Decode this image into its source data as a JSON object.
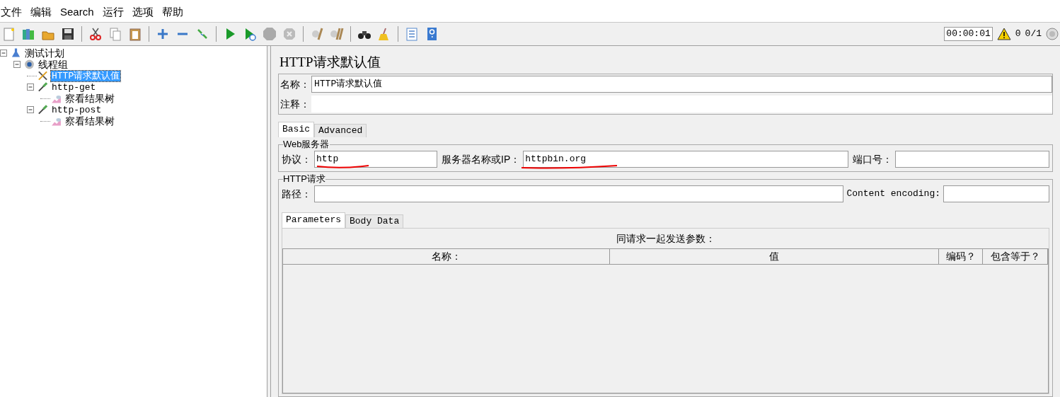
{
  "menu": [
    "文件",
    "编辑",
    "Search",
    "运行",
    "选项",
    "帮助"
  ],
  "status": {
    "timer": "00:00:01",
    "warnings": "0",
    "threads": "0/1"
  },
  "tree": [
    {
      "label": "测试计划",
      "kind": "plan",
      "selected": false,
      "expanded": true,
      "children": [
        {
          "label": "线程组",
          "kind": "threads",
          "selected": false,
          "expanded": true,
          "children": [
            {
              "label": "HTTP请求默认值",
              "kind": "config",
              "selected": true
            },
            {
              "label": "http-get",
              "kind": "sampler",
              "selected": false,
              "expanded": true,
              "children": [
                {
                  "label": "察看结果树",
                  "kind": "listener",
                  "selected": false
                }
              ]
            },
            {
              "label": "http-post",
              "kind": "sampler",
              "selected": false,
              "expanded": true,
              "children": [
                {
                  "label": "察看结果树",
                  "kind": "listener",
                  "selected": false
                }
              ]
            }
          ]
        }
      ]
    }
  ],
  "panel": {
    "title": "HTTP请求默认值",
    "name_label": "名称：",
    "name_value": "HTTP请求默认值",
    "comment_label": "注释："
  },
  "tabs": [
    {
      "label": "Basic",
      "selected": true
    },
    {
      "label": "Advanced",
      "selected": false
    }
  ],
  "web_server": {
    "legend": "Web服务器",
    "protocol_label": "协议：",
    "protocol": "http",
    "server_label": "服务器名称或IP：",
    "server": "httpbin.org",
    "port_label": "端口号："
  },
  "http_request": {
    "legend": "HTTP请求",
    "path_label": "路径：",
    "encoding_label": "Content encoding:"
  },
  "sub_tabs": [
    {
      "label": "Parameters",
      "selected": true
    },
    {
      "label": "Body Data",
      "selected": false
    }
  ],
  "params": {
    "caption": "同请求一起发送参数：",
    "columns": [
      "名称：",
      "值",
      "编码？",
      "包含等于？"
    ]
  }
}
